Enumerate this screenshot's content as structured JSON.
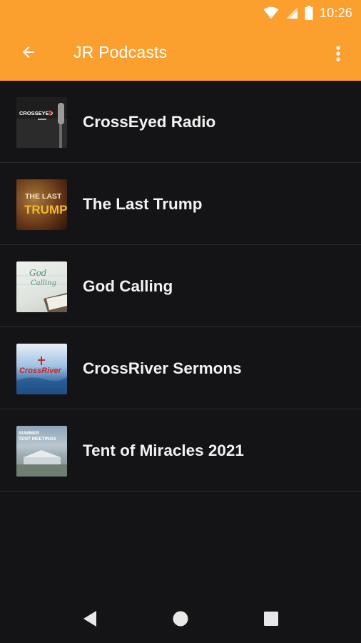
{
  "status_bar": {
    "time": "10:26"
  },
  "app_bar": {
    "title": "JR Podcasts",
    "accent_color": "#FBA02E"
  },
  "thumbnails": {
    "crosseyed": "CROSSEYED",
    "last_trump_line1": "THE LAST",
    "last_trump_line2": "TRUMP",
    "god_calling_line1": "God",
    "god_calling_line2": "Calling",
    "crossriver": "CrossRiver",
    "tent_line1": "SUMMER",
    "tent_line2": "TENT MEETINGS"
  },
  "podcasts": [
    {
      "title": "CrossEyed Radio"
    },
    {
      "title": "The Last Trump"
    },
    {
      "title": "God Calling"
    },
    {
      "title": "CrossRiver Sermons"
    },
    {
      "title": "Tent of Miracles 2021"
    }
  ]
}
